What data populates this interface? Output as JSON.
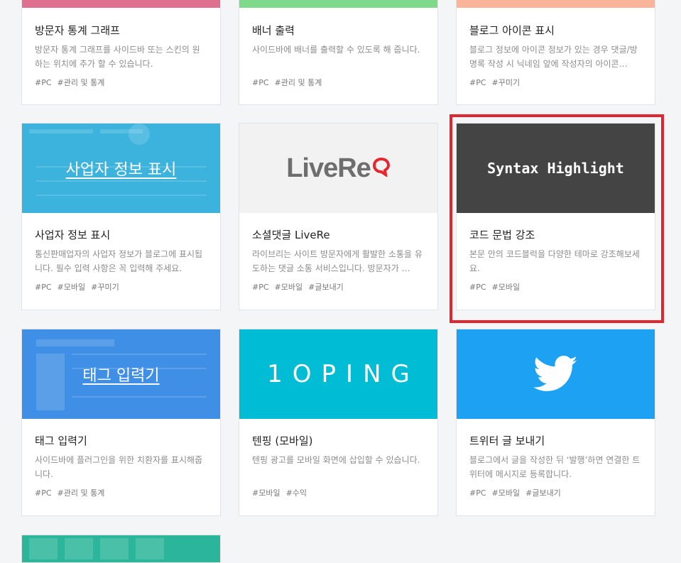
{
  "cards": [
    {
      "title": "방문자 통계 그래프",
      "desc": "방문자 통계 그래프를 사이드바 또는 스킨의 원하는 위치에 추가 할 수 있습니다.",
      "tags": [
        "#PC",
        "#관리 및 통계"
      ],
      "color": "#e0708f"
    },
    {
      "title": "배너 출력",
      "desc": "사이드바에 배너를 출력할 수 있도록 해 줍니다.",
      "tags": [
        "#PC",
        "#관리 및 통계"
      ],
      "color": "#7ed98a"
    },
    {
      "title": "블로그 아이콘 표시",
      "desc": "블로그 정보에 아이콘 정보가 있는 경우 댓글/방명록 작성 시 닉네임 앞에 작성자의 아이콘…",
      "tags": [
        "#PC",
        "#꾸미기"
      ],
      "color": "#f9b49a"
    },
    {
      "title": "사업자 정보 표시",
      "desc": "통신판매업자의 사업자 정보가 블로그에 표시됩니다. 필수 입력 사항은 꼭 입력해 주세요.",
      "tags": [
        "#PC",
        "#모바일",
        "#꾸미기"
      ],
      "thumb": "사업자 정보 표시",
      "color": "#3bb3dd"
    },
    {
      "title": "소셜댓글 LiveRe",
      "desc": "라이브리는 사이트 방문자에게 활발한 소통을 유도하는 댓글 소통 서비스입니다. 방문자가 …",
      "tags": [
        "#PC",
        "#모바일",
        "#글보내기"
      ],
      "thumb": "LiveRe",
      "color": "#f2f2f2"
    },
    {
      "title": "코드 문법 강조",
      "desc": "본문 안의 코드블럭을 다양한 테마로 강조해보세요.",
      "tags": [
        "#PC",
        "#모바일"
      ],
      "thumb": "Syntax Highlight",
      "color": "#444444"
    },
    {
      "title": "태그 입력기",
      "desc": "사이드바에 플러그인을 위한 치환자를 표시해줍니다.",
      "tags": [
        "#PC",
        "#관리 및 통계"
      ],
      "thumb": "태그 입력기",
      "color": "#3f8fe6"
    },
    {
      "title": "텐핑 (모바일)",
      "desc": "텐핑 광고를 모바일 화면에 삽입할 수 있습니다.",
      "tags": [
        "#모바일",
        "#수익"
      ],
      "thumb": "1OPING",
      "color": "#00bcd4"
    },
    {
      "title": "트위터 글 보내기",
      "desc": "블로그에서 글을 작성한 뒤 ‘발행’하면 연결한 트위터에 메시지로 등록합니다.",
      "tags": [
        "#PC",
        "#모바일",
        "#글보내기"
      ],
      "thumb_icon": "twitter-bird-icon",
      "color": "#1da1f2"
    },
    {
      "color": "#2bb59a"
    }
  ],
  "highlight_color": "#e0262e"
}
